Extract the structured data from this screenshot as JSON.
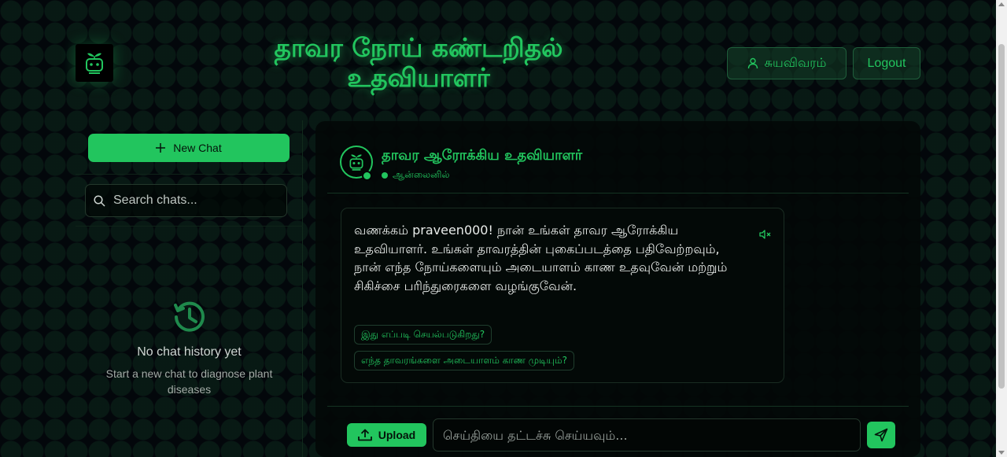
{
  "header": {
    "title_line1": "தாவர நோய் கண்டறிதல்",
    "title_line2": "உதவியாளர்",
    "profile_label": "சுயவிவரம்",
    "logout_label": "Logout"
  },
  "sidebar": {
    "new_chat_label": "New Chat",
    "search_placeholder": "Search chats...",
    "empty_title": "No chat history yet",
    "empty_subtitle": "Start a new chat to diagnose plant diseases"
  },
  "chat": {
    "bot_name": "தாவர ஆரோக்கிய உதவியாளர்",
    "bot_status": "ஆன்லைனில்",
    "message_text": "வணக்கம் praveen000! நான் உங்கள் தாவர ஆரோக்கிய உதவியாளர். உங்கள் தாவரத்தின் புகைப்படத்தை பதிவேற்றவும், நான் எந்த நோய்களையும் அடையாளம் காண உதவுவேன் மற்றும் சிகிச்சை பரிந்துரைகளை வழங்குவேன்.",
    "suggestions": [
      "இது எப்படி செயல்படுகிறது?",
      "எந்த தாவரங்களை அடையாளம் காண முடியும்?"
    ],
    "upload_label": "Upload",
    "input_placeholder": "செய்தியை தட்டச்சு செய்யவும்..."
  },
  "theme": {
    "accent": "#22c55e",
    "background": "#03070b"
  },
  "icons": [
    "robot-logo-icon",
    "user-icon",
    "plus-icon",
    "search-icon",
    "history-icon",
    "bot-avatar-icon",
    "mute-icon",
    "upload-icon",
    "send-icon"
  ]
}
